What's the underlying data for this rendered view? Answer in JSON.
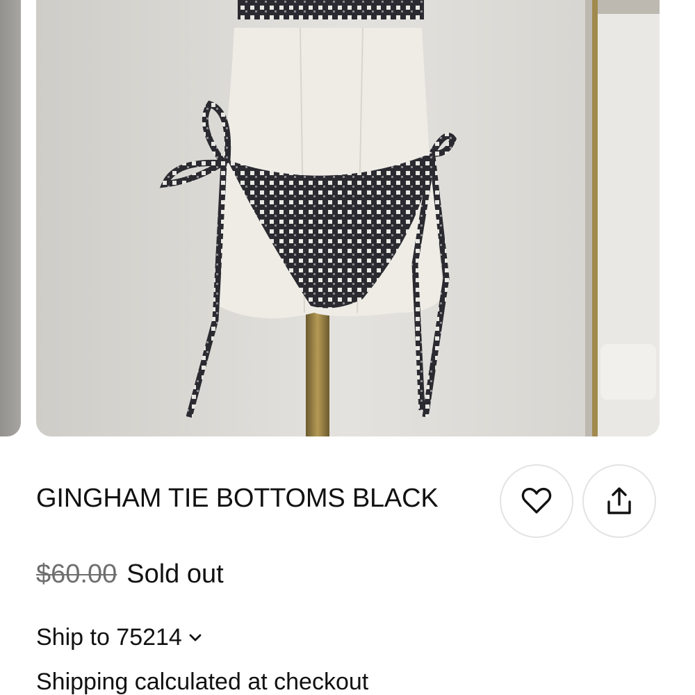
{
  "product": {
    "title": "GINGHAM TIE BOTTOMS BLACK",
    "original_price": "$60.00",
    "availability": "Sold out"
  },
  "actions": {
    "favorite_icon": "heart-icon",
    "share_icon": "share-upload-icon"
  },
  "shipping": {
    "ship_to": "Ship to 75214",
    "note": "Shipping calculated at checkout"
  },
  "colors": {
    "text": "#111111",
    "muted_price": "#6e6e6e",
    "button_border": "#e3e3e3"
  }
}
